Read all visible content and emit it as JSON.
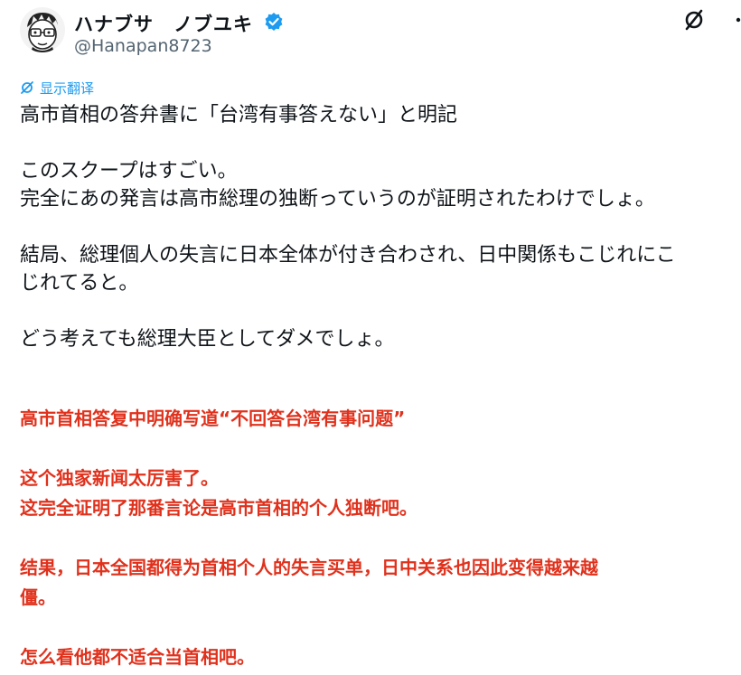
{
  "user": {
    "display_name": "ハナブサ　ノブユキ",
    "handle": "@Hanapan8723"
  },
  "translate_label": "显示翻译",
  "post_lines": [
    "高市首相の答弁書に「台湾有事答えない」と明記",
    "",
    "このスクープはすごい。",
    "完全にあの発言は高市総理の独断っていうのが証明されたわけでしょ。",
    "",
    "結局、総理個人の失言に日本全体が付き合わされ、日中関係もこじれにこ",
    "じれてると。",
    "",
    "どう考えても総理大臣としてダメでしょ。"
  ],
  "translation_lines": [
    "高市首相答复中明确写道“不回答台湾有事问题”",
    "",
    "这个独家新闻太厉害了。",
    "这完全证明了那番言论是高市首相的个人独断吧。",
    "",
    "结果，日本全国都得为首相个人的失言买单，日中关系也因此变得越来越",
    "僵。",
    "",
    "怎么看他都不适合当首相吧。"
  ],
  "colors": {
    "link_blue": "#1d9bf0",
    "verified_blue": "#1d9bf0",
    "translation_red": "#e0311c",
    "text": "#0f1419",
    "handle_gray": "#536471"
  },
  "icons": [
    "avatar-caricature",
    "verified-badge-icon",
    "grok-icon",
    "translate-icon"
  ]
}
